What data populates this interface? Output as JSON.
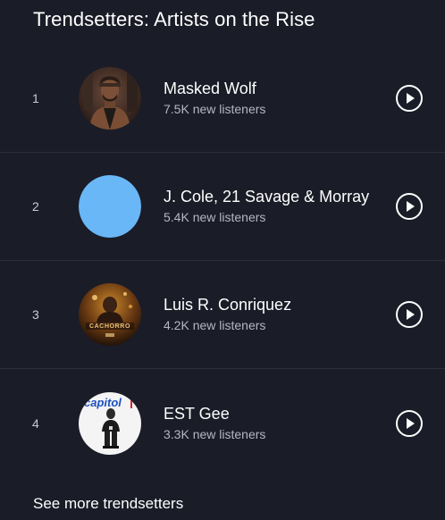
{
  "section": {
    "title": "Trendsetters: Artists on the Rise",
    "see_more": "See more trendsetters"
  },
  "artists": [
    {
      "rank": "1",
      "name": "Masked Wolf",
      "listeners": "7.5K new listeners",
      "avatar": "artist-photo"
    },
    {
      "rank": "2",
      "name": "J. Cole, 21 Savage & Morray",
      "listeners": "5.4K new listeners",
      "avatar": "blue-placeholder",
      "avatar_color": "#6ab7f7"
    },
    {
      "rank": "3",
      "name": "Luis R. Conriquez",
      "listeners": "4.2K new listeners",
      "avatar": "album-art",
      "avatar_text": "CACHORRO"
    },
    {
      "rank": "4",
      "name": "EST Gee",
      "listeners": "3.3K new listeners",
      "avatar": "artist-photo",
      "avatar_text": "capitol"
    }
  ],
  "icons": {
    "play": "play-circle-icon"
  }
}
